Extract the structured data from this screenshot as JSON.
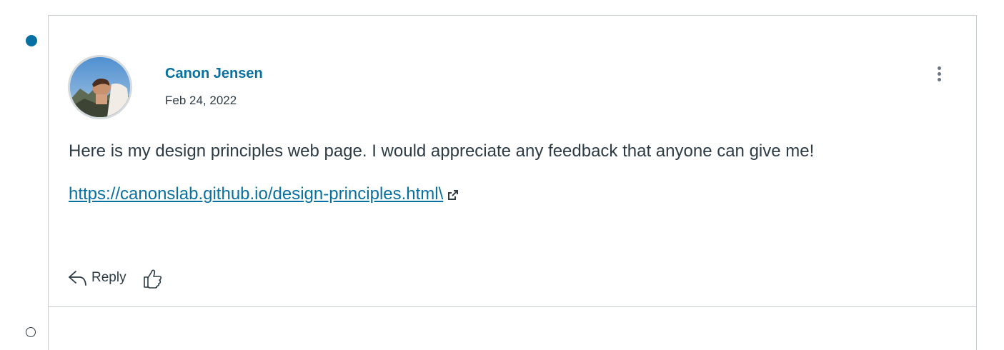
{
  "post": {
    "author": "Canon Jensen",
    "date": "Feb 24, 2022",
    "message": "Here is my design principles web page. I would appreciate any feedback that anyone can give me!",
    "link_text": "https://canonslab.github.io/design-principles.html\\",
    "reply_label": "Reply",
    "unread": true
  },
  "icons": {
    "unread_indicator": "filled-dot",
    "read_indicator": "hollow-dot",
    "menu": "kebab-icon",
    "external_link": "external-link-icon",
    "reply": "reply-arrow-icon",
    "like": "thumbs-up-icon"
  },
  "colors": {
    "accent": "#0770a3",
    "text": "#2d3b45",
    "border": "#c7cdd1",
    "muted_icon": "#6b7780"
  }
}
